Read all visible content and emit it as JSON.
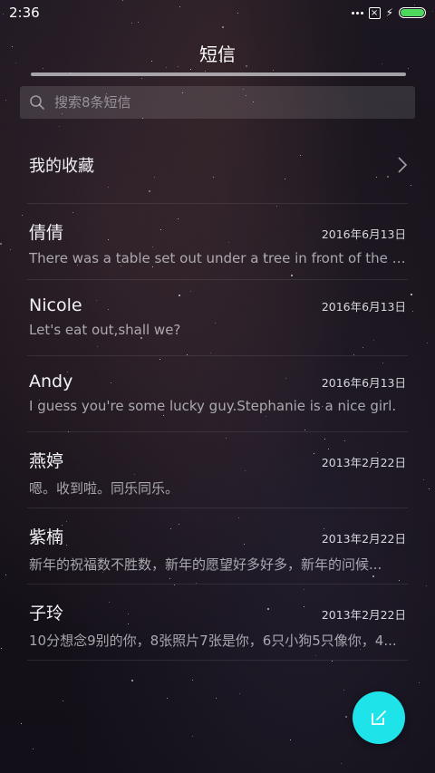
{
  "status_bar": {
    "time": "2:36"
  },
  "header": {
    "title": "短信"
  },
  "search": {
    "placeholder": "搜索8条短信"
  },
  "favorites": {
    "label": "我的收藏"
  },
  "messages": [
    {
      "name": "倩倩",
      "date": "2016年6月13日",
      "preview": "There was a table set out under a tree in front of the ho..."
    },
    {
      "name": "Nicole",
      "date": "2016年6月13日",
      "preview": "Let's eat out,shall we?"
    },
    {
      "name": "Andy",
      "date": "2016年6月13日",
      "preview": "I guess you're some lucky guy.Stephanie is a nice girl."
    },
    {
      "name": "燕婷",
      "date": "2013年2月22日",
      "preview": "嗯。收到啦。同乐同乐。"
    },
    {
      "name": "紫楠",
      "date": "2013年2月22日",
      "preview": "新年的祝福数不胜数，新年的愿望好多好多，新年的问候..."
    },
    {
      "name": "子玲",
      "date": "2013年2月22日",
      "preview": "10分想念9别的你，8张照片7张是你，6只小狗5只像你，4..."
    }
  ],
  "icons": {
    "search": "search-icon",
    "chevron": "chevron-right-icon",
    "compose": "compose-icon",
    "battery": "battery-icon"
  },
  "colors": {
    "accent": "#1ee3e8",
    "battery": "#4cd95c"
  }
}
